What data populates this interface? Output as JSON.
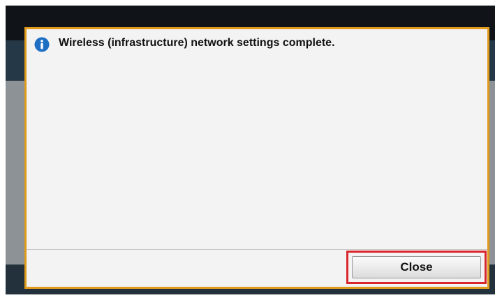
{
  "dialog": {
    "message": "Wireless (infrastructure) network settings complete.",
    "icon": "info-icon",
    "close_label": "Close"
  },
  "colors": {
    "dialog_border": "#e09a1c",
    "highlight": "#d9262c",
    "info_icon": "#1e6fc4"
  }
}
